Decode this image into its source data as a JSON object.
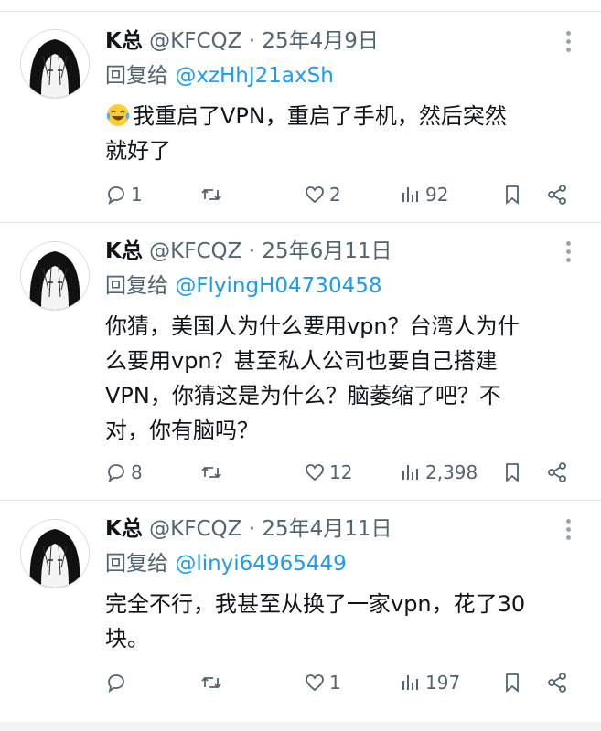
{
  "tweets": [
    {
      "name": "K总",
      "handle": "@KFCQZ",
      "dot": "·",
      "date": "25年4月9日",
      "reply_prefix": "回复给",
      "reply_to": "@xzHhJ21axSh",
      "emoji_icon": "laughing-crying-emoji",
      "text_line1": "我重启了VPN，重启了手机，然后突然",
      "text_line2": "就好了",
      "replies": "1",
      "retweets": "",
      "likes": "2",
      "views": "92"
    },
    {
      "name": "K总",
      "handle": "@KFCQZ",
      "dot": "·",
      "date": "25年6月11日",
      "reply_prefix": "回复给",
      "reply_to": "@FlyingH04730458",
      "text_line1": "你猜，美国人为什么要用vpn？台湾人为什",
      "text_line2": "么要用vpn？甚至私人公司也要自己搭建",
      "text_line3": "VPN，你猜这是为什么？脑萎缩了吧？不",
      "text_line4": "对，你有脑吗？",
      "replies": "8",
      "retweets": "",
      "likes": "12",
      "views": "2,398"
    },
    {
      "name": "K总",
      "handle": "@KFCQZ",
      "dot": "·",
      "date": "25年4月11日",
      "reply_prefix": "回复给",
      "reply_to": "@linyi64965449",
      "text_line1": "完全不行，我甚至从换了一家vpn，花了30",
      "text_line2": "块。",
      "replies": "",
      "retweets": "",
      "likes": "1",
      "views": "197"
    }
  ],
  "icons": {
    "reply": "reply-icon",
    "retweet": "retweet-icon",
    "like": "heart-icon",
    "views": "views-icon",
    "bookmark": "bookmark-icon",
    "share": "share-icon",
    "more": "more-icon"
  },
  "colors": {
    "text": "#0f1419",
    "secondary": "#536471",
    "link": "#1d9bf0"
  }
}
